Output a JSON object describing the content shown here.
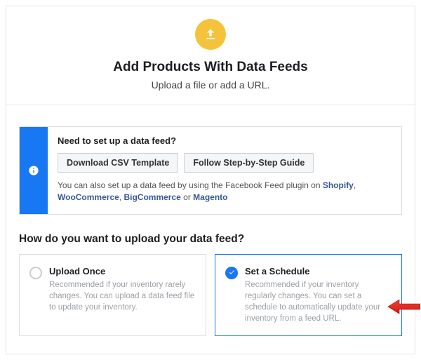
{
  "hero": {
    "title": "Add Products With Data Feeds",
    "subtitle": "Upload a file or add a URL."
  },
  "infobox": {
    "title": "Need to set up a data feed?",
    "download_btn": "Download CSV Template",
    "guide_btn": "Follow Step-by-Step Guide",
    "text_prefix": "You can also set up a data feed by using the Facebook Feed plugin on ",
    "text_or": " or ",
    "links": {
      "shopify": "Shopify",
      "woocommerce": "WooCommerce",
      "bigcommerce": "BigCommerce",
      "magento": "Magento"
    }
  },
  "upload_question": "How do you want to upload your data feed?",
  "options": {
    "once": {
      "title": "Upload Once",
      "desc": "Recommended if your inventory rarely changes. You can upload a data feed file to update your inventory."
    },
    "schedule": {
      "title": "Set a Schedule",
      "desc": "Recommended if your inventory regularly changes. You can set a schedule to automatically update your inventory from a feed URL."
    }
  }
}
